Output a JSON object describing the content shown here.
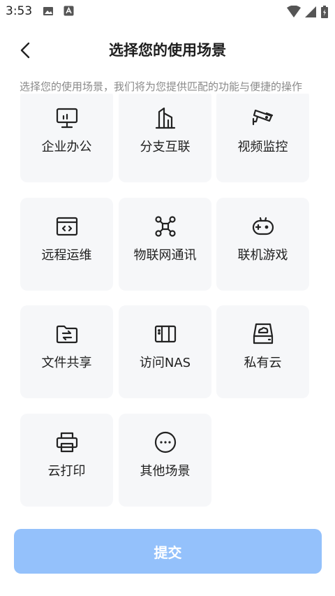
{
  "status_bar": {
    "time": "3:53"
  },
  "header": {
    "title": "选择您的使用场景"
  },
  "subtitle": "选择您的使用场景，我们将为您提供匹配的功能与便捷的操作",
  "scenarios": [
    {
      "label": "企业办公",
      "icon": "monitor-icon"
    },
    {
      "label": "分支互联",
      "icon": "building-icon"
    },
    {
      "label": "视频监控",
      "icon": "cctv-camera-icon"
    },
    {
      "label": "远程运维",
      "icon": "code-window-icon"
    },
    {
      "label": "物联网通讯",
      "icon": "network-nodes-icon"
    },
    {
      "label": "联机游戏",
      "icon": "gamepad-icon"
    },
    {
      "label": "文件共享",
      "icon": "folder-share-icon"
    },
    {
      "label": "访问NAS",
      "icon": "nas-icon"
    },
    {
      "label": "私有云",
      "icon": "cloud-drive-icon"
    },
    {
      "label": "云打印",
      "icon": "printer-icon"
    },
    {
      "label": "其他场景",
      "icon": "more-icon"
    }
  ],
  "submit_label": "提交",
  "colors": {
    "submit_bg": "#94c1fb",
    "card_bg": "#f6f7f9",
    "subtitle": "#8a8a8a"
  }
}
